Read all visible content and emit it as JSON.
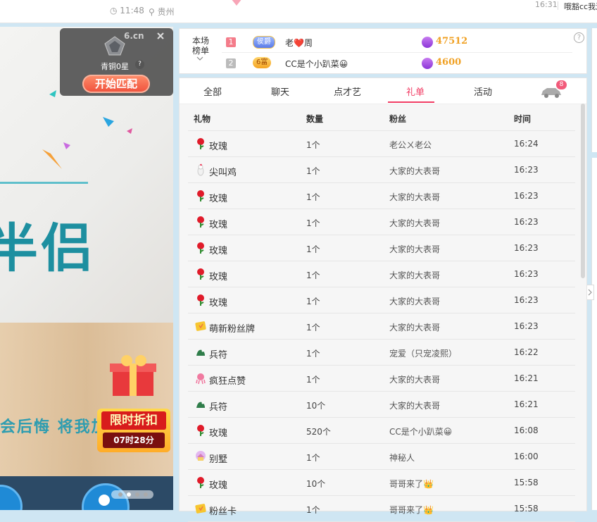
{
  "topbar": {
    "time": "11:48",
    "location": "贵州",
    "right_time": "16:31",
    "right_text": "哦豁cc我没"
  },
  "video": {
    "big_text": "半侣",
    "sub_text": "会后悔 将我加",
    "logo": "6.cn",
    "rank_label": "青铜0星",
    "help": "?",
    "match_button": "开始匹配",
    "promo_title": "限时折扣",
    "promo_timer": "07时28分"
  },
  "leaderboard": {
    "label_line1": "本场",
    "label_line2": "榜单",
    "rows": [
      {
        "rank": "1",
        "badge": "侯爵",
        "name": "老❤️周",
        "score": "47512"
      },
      {
        "rank": "2",
        "badge": "6富",
        "name": "CC是个小趴菜😀",
        "score": "4600"
      }
    ],
    "help": "?"
  },
  "tabs": {
    "items": [
      "全部",
      "聊天",
      "点才艺",
      "礼单",
      "活动"
    ],
    "active": "礼单",
    "car_badge": "8"
  },
  "table": {
    "headers": {
      "gift": "礼物",
      "qty": "数量",
      "fan": "粉丝",
      "time": "时间"
    },
    "rows": [
      {
        "icon": "rose-icon",
        "gift": "玫瑰",
        "qty": "1个",
        "fan": "老公ㄨ老公",
        "time": "16:24"
      },
      {
        "icon": "chicken-icon",
        "gift": "尖叫鸡",
        "qty": "1个",
        "fan": "大家的大表哥",
        "time": "16:23"
      },
      {
        "icon": "rose-icon",
        "gift": "玫瑰",
        "qty": "1个",
        "fan": "大家的大表哥",
        "time": "16:23"
      },
      {
        "icon": "rose-icon",
        "gift": "玫瑰",
        "qty": "1个",
        "fan": "大家的大表哥",
        "time": "16:23"
      },
      {
        "icon": "rose-icon",
        "gift": "玫瑰",
        "qty": "1个",
        "fan": "大家的大表哥",
        "time": "16:23"
      },
      {
        "icon": "rose-icon",
        "gift": "玫瑰",
        "qty": "1个",
        "fan": "大家的大表哥",
        "time": "16:23"
      },
      {
        "icon": "rose-icon",
        "gift": "玫瑰",
        "qty": "1个",
        "fan": "大家的大表哥",
        "time": "16:23"
      },
      {
        "icon": "fan-card-icon",
        "gift": "萌新粉丝牌",
        "qty": "1个",
        "fan": "大家的大表哥",
        "time": "16:23"
      },
      {
        "icon": "dragon-icon",
        "gift": "兵符",
        "qty": "1个",
        "fan": "宠爱（只宠凌熙）",
        "time": "16:22"
      },
      {
        "icon": "octopus-icon",
        "gift": "疯狂点赞",
        "qty": "1个",
        "fan": "大家的大表哥",
        "time": "16:21"
      },
      {
        "icon": "dragon-icon",
        "gift": "兵符",
        "qty": "10个",
        "fan": "大家的大表哥",
        "time": "16:21"
      },
      {
        "icon": "rose-icon",
        "gift": "玫瑰",
        "qty": "520个",
        "fan": "CC是个小趴菜😀",
        "time": "16:08"
      },
      {
        "icon": "villa-icon",
        "gift": "别墅",
        "qty": "1个",
        "fan": "神秘人",
        "time": "16:00"
      },
      {
        "icon": "rose-icon",
        "gift": "玫瑰",
        "qty": "10个",
        "fan": "哥哥来了👑",
        "time": "15:58"
      },
      {
        "icon": "fan-card-icon",
        "gift": "粉丝卡",
        "qty": "1个",
        "fan": "哥哥来了👑",
        "time": "15:58"
      }
    ]
  },
  "colors": {
    "accent": "#f13c64",
    "score": "#f0a022",
    "background": "#cfe6f3",
    "teal_text": "#1d8fa0"
  }
}
